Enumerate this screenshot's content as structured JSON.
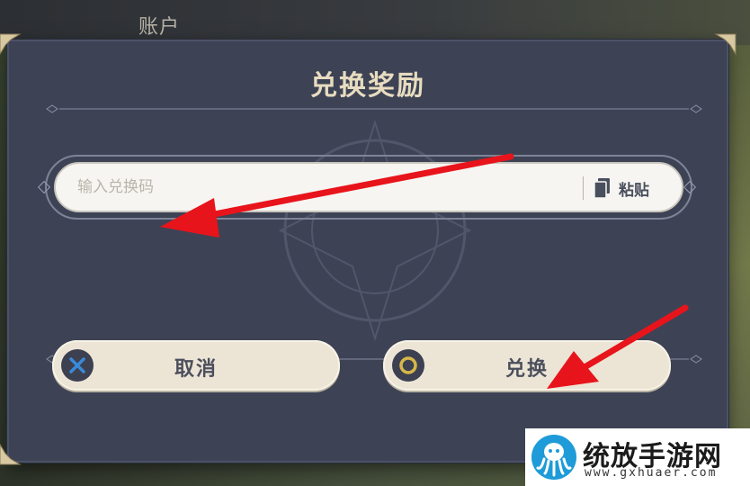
{
  "background": {
    "account_label": "账户"
  },
  "dialog": {
    "title": "兑换奖励",
    "code_input": {
      "placeholder": "输入兑换码",
      "value": ""
    },
    "paste_label": "粘贴",
    "cancel_label": "取消",
    "confirm_label": "兑换"
  },
  "watermark": {
    "name": "统放手游网",
    "url": "www.gxhuaer.com"
  },
  "colors": {
    "dialog_bg": "#3d4355",
    "title": "#e8dcc0",
    "button_bg": "#ece5d6",
    "arrow": "#e8141b",
    "cancel_icon": "#3a8ad8",
    "confirm_icon": "#d7b64a"
  }
}
